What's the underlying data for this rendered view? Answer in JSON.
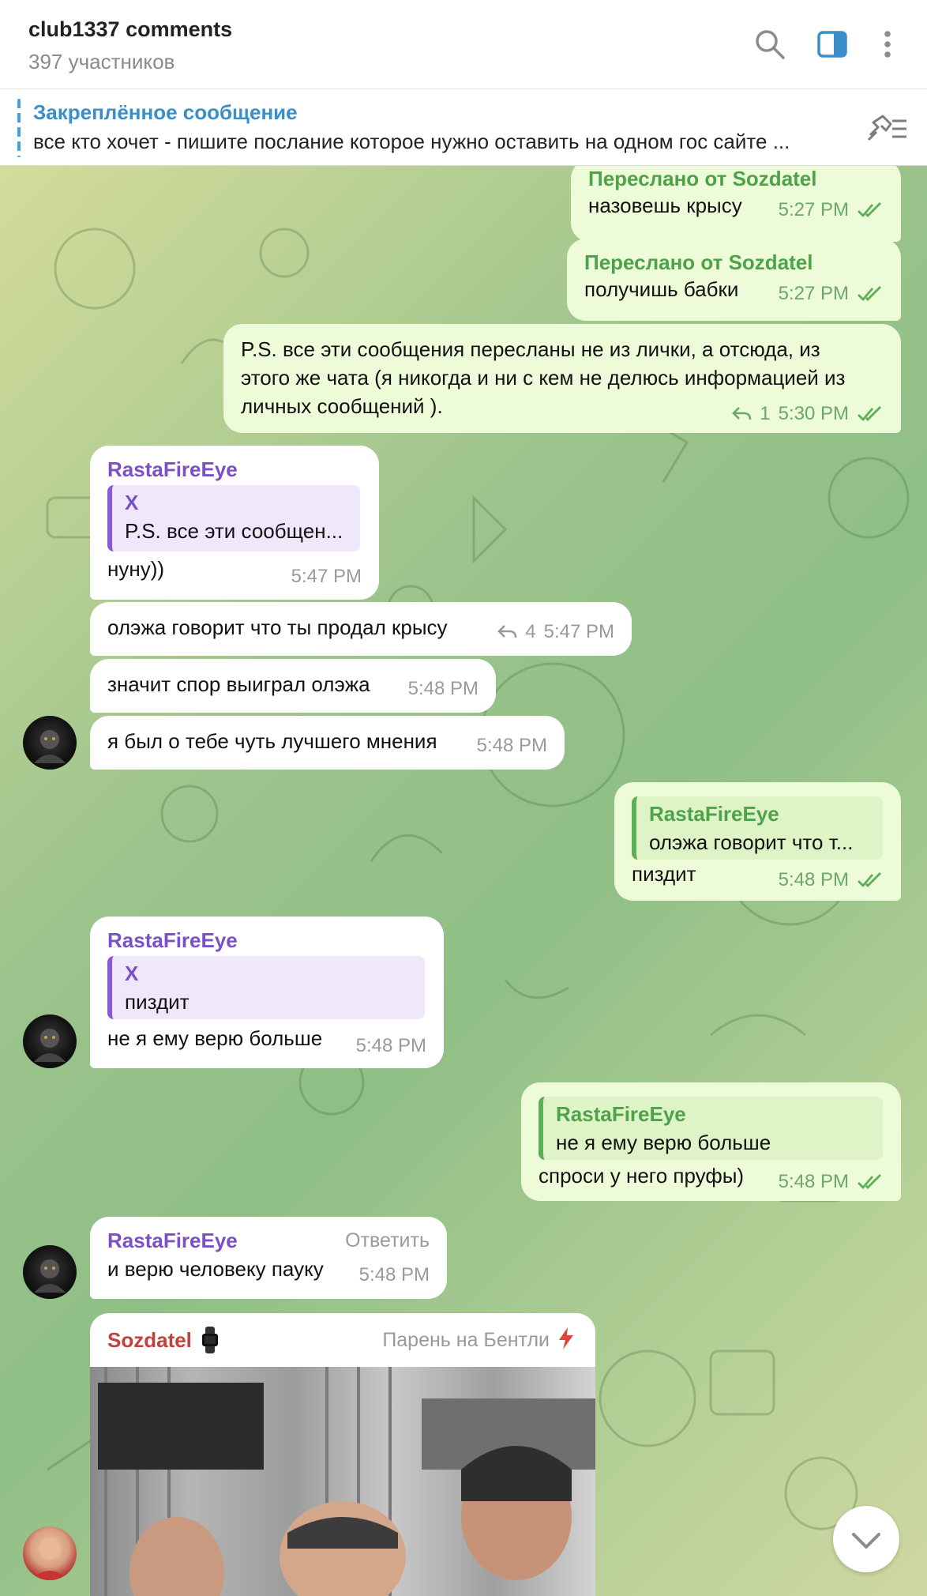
{
  "header": {
    "title": "club1337 comments",
    "subtitle": "397 участников"
  },
  "pinned": {
    "title": "Закреплённое сообщение",
    "text": "все кто хочет - пишите послание которое нужно оставить на одном гос сайте ..."
  },
  "messages": {
    "m1": {
      "forwarded": "Переслано от Sozdatel",
      "text": "назовешь крысу",
      "time": "5:27 PM"
    },
    "m2": {
      "forwarded": "Переслано от Sozdatel",
      "text": "получишь бабки",
      "time": "5:27 PM"
    },
    "m3": {
      "line1": "P.S. все эти сообщения пересланы не из лички, а отсюда, из",
      "line2": "этого же  чата (я никогда и ни с кем не делюсь информацией из",
      "line3": "личных сообщений ).",
      "replies": "1",
      "time": "5:30 PM"
    },
    "m4": {
      "sender": "RastaFireEye",
      "quote_name": "X",
      "quote_text": "P.S. все эти сообщен...",
      "text": "нуну))",
      "time": "5:47 PM"
    },
    "m5": {
      "text": "олэжа говорит что ты продал крысу",
      "replies": "4",
      "time": "5:47 PM"
    },
    "m6": {
      "text": "значит спор выиграл олэжа",
      "time": "5:48 PM"
    },
    "m7": {
      "text": "я был о тебе чуть лучшего мнения",
      "time": "5:48 PM"
    },
    "m8": {
      "quote_name": "RastaFireEye",
      "quote_text": "олэжа говорит что т...",
      "text": "пиздит",
      "time": "5:48 PM"
    },
    "m9": {
      "sender": "RastaFireEye",
      "quote_name": "X",
      "quote_text": "пиздит",
      "text": "не я ему верю больше",
      "time": "5:48 PM"
    },
    "m10": {
      "quote_name": "RastaFireEye",
      "quote_text": "не я ему верю больше",
      "text": "спроси у него пруфы)",
      "time": "5:48 PM"
    },
    "m11": {
      "sender": "RastaFireEye",
      "action": "Ответить",
      "text": "и верю человеку пауку",
      "time": "5:48 PM"
    },
    "m12": {
      "sender": "Sozdatel",
      "title": "Парень на Бентли"
    }
  },
  "colors": {
    "forward_green": "#4ea24a",
    "sender_purple": "#7b4fc8",
    "sender_red": "#c2413a",
    "link_blue": "#3a8fcb",
    "outgoing_bubble": "#eefbd9"
  },
  "icons": [
    "search-icon",
    "sidebar-toggle-icon",
    "more-icon",
    "pin-list-icon",
    "reply-arrow-icon",
    "read-ticks-icon",
    "chevron-down-icon",
    "watch-emoji-icon",
    "lightning-icon"
  ]
}
